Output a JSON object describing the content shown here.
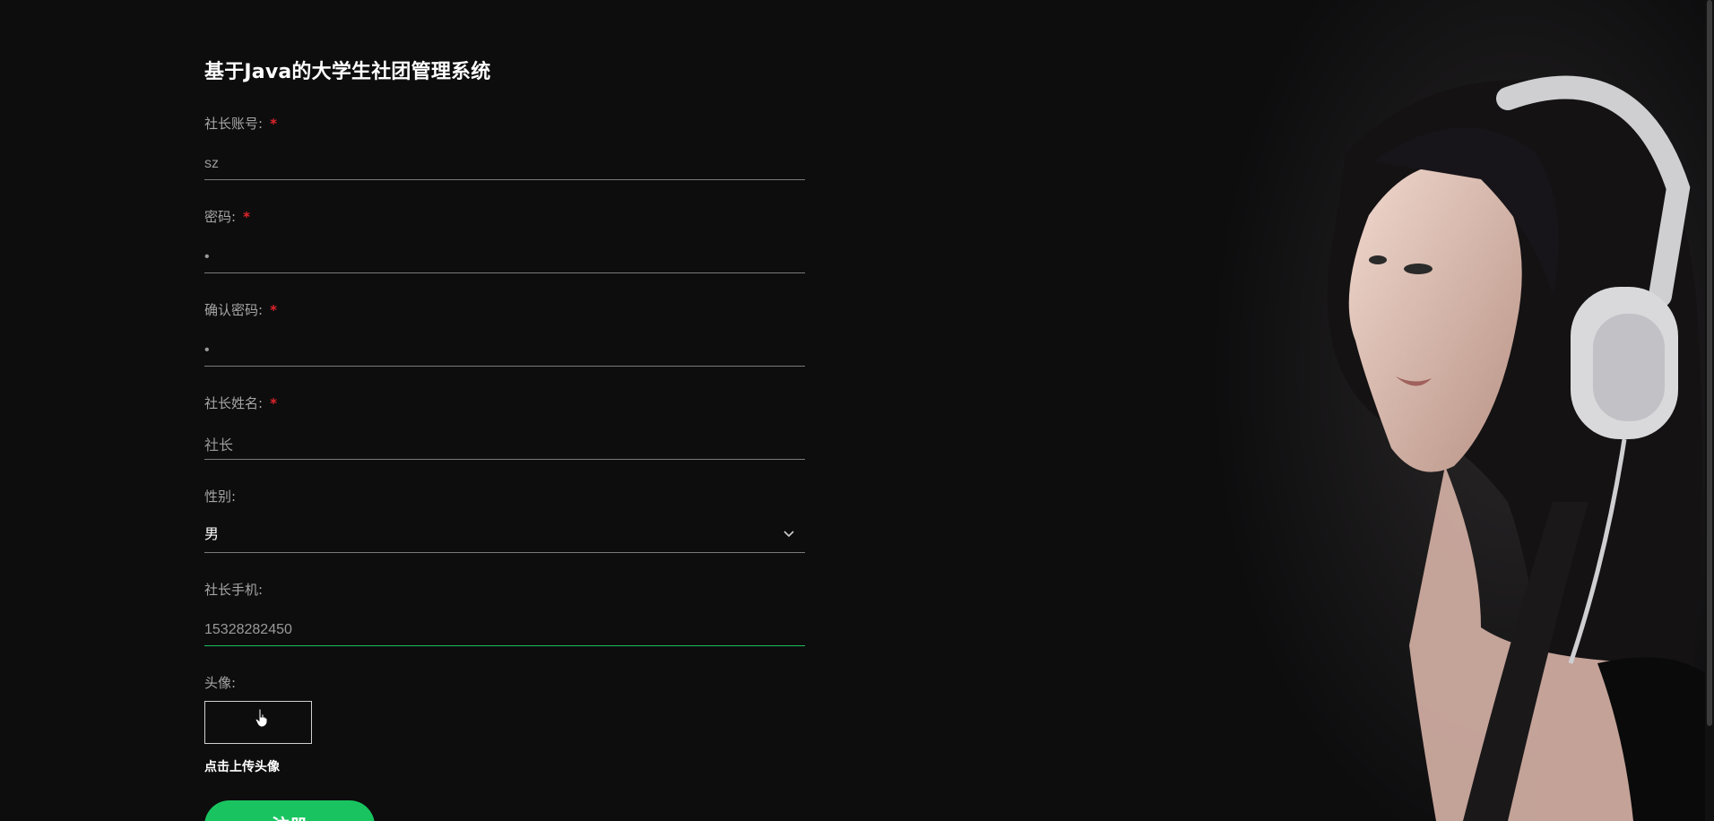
{
  "title": "基于Java的大学生社团管理系统",
  "form": {
    "account": {
      "label": "社长账号:",
      "required": "*",
      "value": "sz"
    },
    "password": {
      "label": "密码:",
      "required": "*",
      "value": "•"
    },
    "confirm_password": {
      "label": "确认密码:",
      "required": "*",
      "value": "•"
    },
    "name": {
      "label": "社长姓名:",
      "required": "*",
      "value": "社长"
    },
    "gender": {
      "label": "性别:",
      "selected": "男"
    },
    "phone": {
      "label": "社长手机:",
      "value": "15328282450"
    },
    "avatar": {
      "label": "头像:",
      "hint": "点击上传头像"
    },
    "submit_label": "注册"
  },
  "colors": {
    "background": "#0d0d0e",
    "accent": "#19c460",
    "required": "#e0242a"
  },
  "icons": {
    "select_arrow": "chevron-down-icon",
    "cursor": "hand-cursor-icon"
  }
}
